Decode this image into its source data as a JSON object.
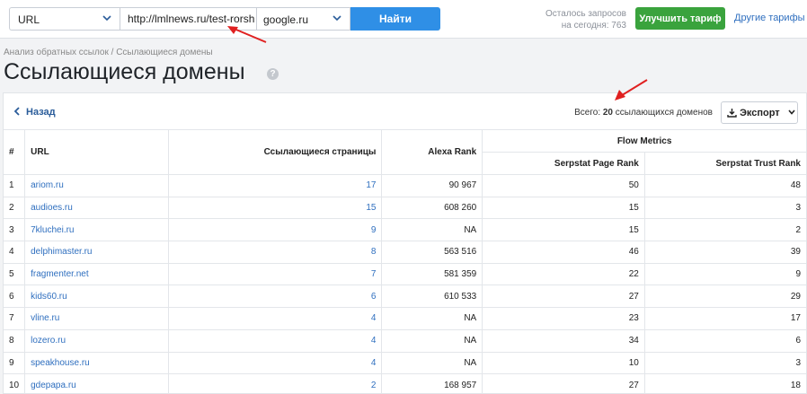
{
  "search": {
    "type_value": "URL",
    "url_value": "http://lmlnews.ru/test-rorsh",
    "engine_value": "google.ru",
    "find_label": "Найти"
  },
  "quota": {
    "line1": "Осталось запросов",
    "line2": "на сегодня: 763"
  },
  "header": {
    "upgrade_label": "Улучшить тариф",
    "other_plans_label": "Другие тарифы"
  },
  "breadcrumb": "Анализ обратных ссылок / Ссылающиеся домены",
  "page_title": "Ссылающиеся домены",
  "toolbar": {
    "back_label": "Назад",
    "total_prefix": "Всего:",
    "total_count": "20",
    "total_suffix": "ссылающихся доменов",
    "export_label": "Экспорт"
  },
  "table": {
    "headers": {
      "idx": "#",
      "url": "URL",
      "pages": "Ссылающиеся страницы",
      "alexa": "Alexa Rank",
      "flow": "Flow Metrics",
      "page_rank": "Serpstat Page Rank",
      "trust_rank": "Serpstat Trust Rank"
    },
    "rows": [
      {
        "n": "1",
        "url": "ariom.ru",
        "pages": "17",
        "alexa": "90 967",
        "page_rank": "50",
        "trust_rank": "48"
      },
      {
        "n": "2",
        "url": "audioes.ru",
        "pages": "15",
        "alexa": "608 260",
        "page_rank": "15",
        "trust_rank": "3"
      },
      {
        "n": "3",
        "url": "7kluchei.ru",
        "pages": "9",
        "alexa": "NA",
        "page_rank": "15",
        "trust_rank": "2"
      },
      {
        "n": "4",
        "url": "delphimaster.ru",
        "pages": "8",
        "alexa": "563 516",
        "page_rank": "46",
        "trust_rank": "39"
      },
      {
        "n": "5",
        "url": "fragmenter.net",
        "pages": "7",
        "alexa": "581 359",
        "page_rank": "22",
        "trust_rank": "9"
      },
      {
        "n": "6",
        "url": "kids60.ru",
        "pages": "6",
        "alexa": "610 533",
        "page_rank": "27",
        "trust_rank": "29"
      },
      {
        "n": "7",
        "url": "vline.ru",
        "pages": "4",
        "alexa": "NA",
        "page_rank": "23",
        "trust_rank": "17"
      },
      {
        "n": "8",
        "url": "lozero.ru",
        "pages": "4",
        "alexa": "NA",
        "page_rank": "34",
        "trust_rank": "6"
      },
      {
        "n": "9",
        "url": "speakhouse.ru",
        "pages": "4",
        "alexa": "NA",
        "page_rank": "10",
        "trust_rank": "3"
      },
      {
        "n": "10",
        "url": "gdepapa.ru",
        "pages": "2",
        "alexa": "168 957",
        "page_rank": "27",
        "trust_rank": "18"
      }
    ]
  },
  "colors": {
    "primary_button": "#2f8fe6",
    "upgrade_button": "#3aa33d",
    "link": "#2f6fbf",
    "annotation_arrow": "#e02020"
  },
  "icons": [
    "chevron-down-icon",
    "chevron-left-icon",
    "download-icon",
    "help-icon",
    "annotation-arrow"
  ]
}
